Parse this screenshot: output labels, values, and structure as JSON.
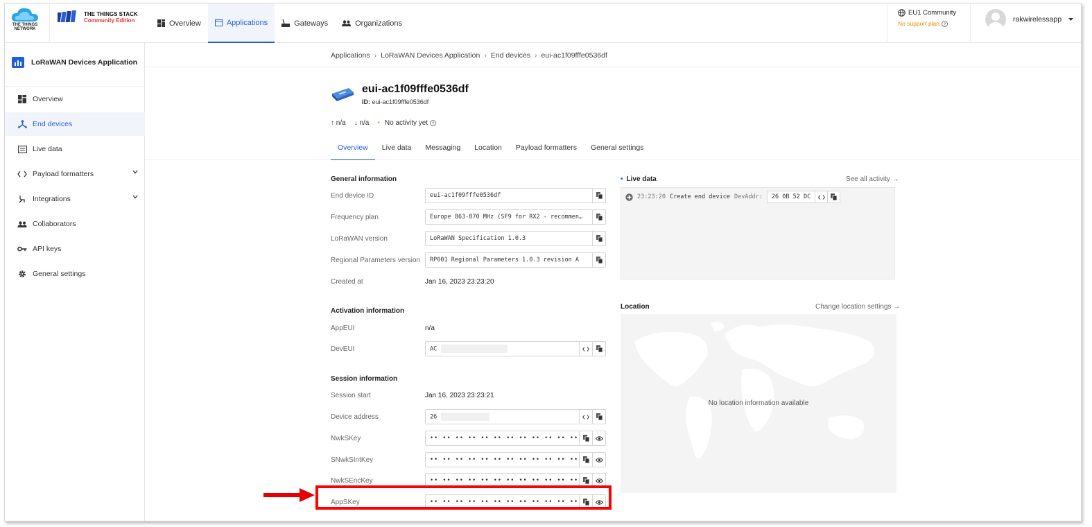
{
  "header": {
    "ttn_logo_text": "THE THINGS NETWORK",
    "stack_title": "THE THINGS STACK",
    "stack_edition": "Community Edition",
    "nav": [
      {
        "label": "Overview",
        "icon": "dashboard-icon",
        "active": false
      },
      {
        "label": "Applications",
        "icon": "applications-icon",
        "active": true
      },
      {
        "label": "Gateways",
        "icon": "gateway-icon",
        "active": false
      },
      {
        "label": "Organizations",
        "icon": "people-icon",
        "active": false
      }
    ],
    "region": "EU1 Community",
    "support": "No support plan",
    "username": "rakwirelessapp"
  },
  "sidebar": {
    "app_name": "LoRaWAN Devices Application",
    "items": [
      {
        "label": "Overview",
        "icon": "dashboard-icon"
      },
      {
        "label": "End devices",
        "icon": "devices-icon",
        "active": true
      },
      {
        "label": "Live data",
        "icon": "live-data-icon"
      },
      {
        "label": "Payload formatters",
        "icon": "code-icon",
        "expandable": true
      },
      {
        "label": "Integrations",
        "icon": "integrations-icon",
        "expandable": true
      },
      {
        "label": "Collaborators",
        "icon": "people-icon"
      },
      {
        "label": "API keys",
        "icon": "key-icon"
      },
      {
        "label": "General settings",
        "icon": "gear-icon"
      }
    ]
  },
  "breadcrumb": [
    "Applications",
    "LoRaWAN Devices Application",
    "End devices",
    "eui-ac1f09fffe0536df"
  ],
  "device": {
    "name": "eui-ac1f09fffe0536df",
    "id_label": "ID:",
    "id_value": "eui-ac1f09fffe0536df",
    "uplink": "n/a",
    "downlink": "n/a",
    "activity": "No activity yet"
  },
  "tabs": [
    "Overview",
    "Live data",
    "Messaging",
    "Location",
    "Payload formatters",
    "General settings"
  ],
  "general": {
    "title": "General information",
    "end_device_id_label": "End device ID",
    "end_device_id": "eui-ac1f09fffe0536df",
    "frequency_plan_label": "Frequency plan",
    "frequency_plan": "Europe 863-870 MHz (SF9 for RX2 - recommen…",
    "lorawan_version_label": "LoRaWAN version",
    "lorawan_version": "LoRaWAN Specification 1.0.3",
    "regional_params_label": "Regional Parameters version",
    "regional_params": "RP001 Regional Parameters 1.0.3 revision A",
    "created_at_label": "Created at",
    "created_at": "Jan 16, 2023 23:23:20"
  },
  "activation": {
    "title": "Activation information",
    "appeui_label": "AppEUI",
    "appeui": "n/a",
    "deveui_label": "DevEUI",
    "deveui": "AC"
  },
  "session": {
    "title": "Session information",
    "start_label": "Session start",
    "start": "Jan 16, 2023 23:23:21",
    "device_address_label": "Device address",
    "device_address": "26",
    "nwkskey_label": "NwkSKey",
    "snwksintkey_label": "SNwkSIntKey",
    "nwksenckey_label": "NwkSEncKey",
    "appskey_label": "AppSKey",
    "masked": "•• •• •• •• •• •• •• •• •• •• •• •• •• •• •• ••"
  },
  "live_data": {
    "title": "Live data",
    "see_all": "See all activity →",
    "event_time": "23:23:20",
    "event_text": "Create end device",
    "event_field_label": "DevAddr:",
    "event_field_value": "26 0B 52 DC"
  },
  "location": {
    "title": "Location",
    "change": "Change location settings →",
    "empty": "No location information available"
  }
}
